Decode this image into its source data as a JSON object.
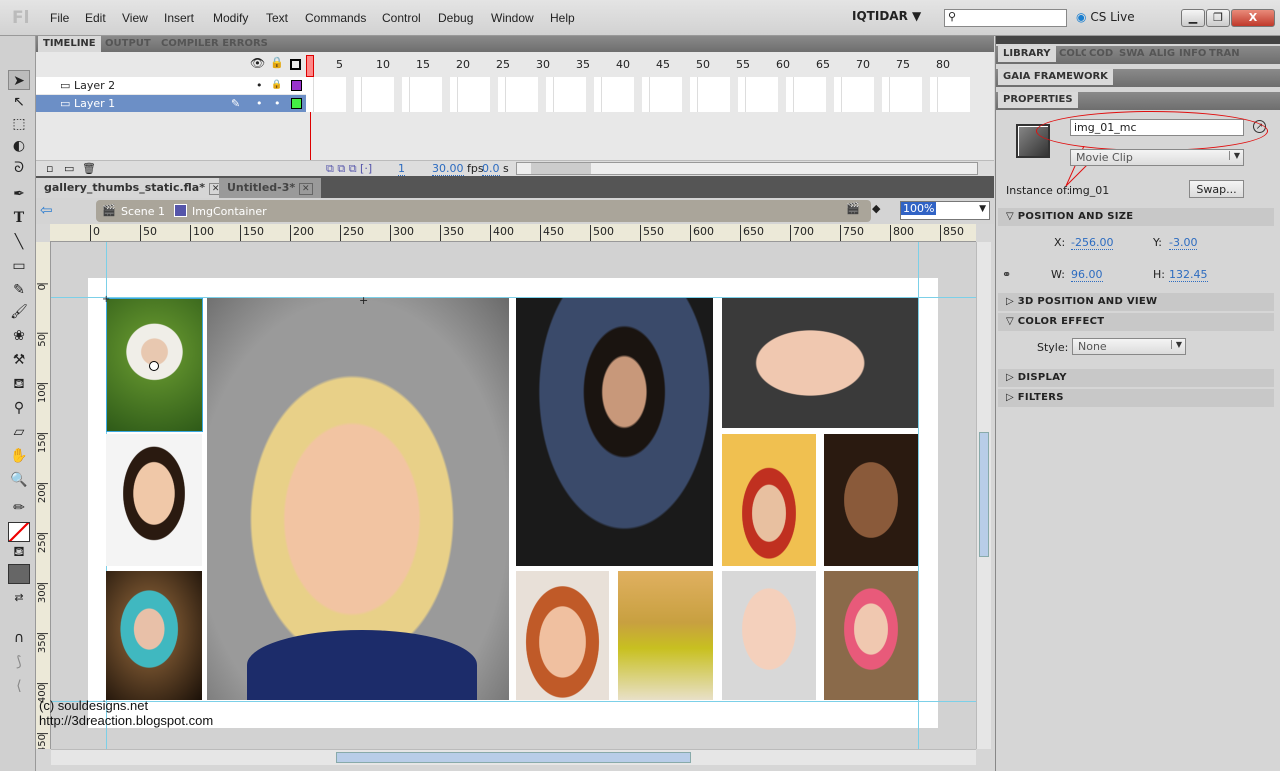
{
  "menubar": {
    "logo": "Fl",
    "items": [
      "File",
      "Edit",
      "View",
      "Insert",
      "Modify",
      "Text",
      "Commands",
      "Control",
      "Debug",
      "Window",
      "Help"
    ],
    "workspace": "IQTIDAR ▼",
    "search_placeholder": "",
    "cs_live": "CS Live"
  },
  "timeline": {
    "tabs": [
      "TIMELINE",
      "OUTPUT",
      "COMPILER ERRORS"
    ],
    "layers": [
      {
        "name": "Layer 2",
        "color": "#9933cc",
        "locked": true,
        "selected": false
      },
      {
        "name": "Layer 1",
        "color": "#44ee44",
        "locked": false,
        "selected": true
      }
    ],
    "frame_numbers": [
      "5",
      "10",
      "15",
      "20",
      "25",
      "30",
      "35",
      "40",
      "45",
      "50",
      "55",
      "60",
      "65",
      "70",
      "75",
      "80"
    ],
    "current_frame": "1",
    "fps": "30.00",
    "fps_unit": "fps",
    "time": "0.0",
    "time_unit": "s"
  },
  "documents": {
    "tabs": [
      "gallery_thumbs_static.fla*",
      "Untitled-3*"
    ],
    "breadcrumb": [
      "Scene 1",
      "ImgContainer"
    ],
    "zoom": "100%"
  },
  "rulers": {
    "horizontal": [
      "0",
      "50",
      "100",
      "150",
      "200",
      "250",
      "300",
      "350",
      "400",
      "450",
      "500",
      "550",
      "600",
      "650",
      "700",
      "750",
      "800",
      "850"
    ],
    "vertical": [
      "0",
      "50",
      "100",
      "150",
      "200",
      "250",
      "300",
      "350",
      "400",
      "450"
    ]
  },
  "watermark": [
    "(c) souldesigns.net",
    "http://3dreaction.blogspot.com"
  ],
  "right_panel": {
    "tabs": [
      "LIBRARY",
      "COLO",
      "COD",
      "SWA",
      "ALIG",
      "INFO",
      "TRAN"
    ],
    "gaia": "GAIA FRAMEWORK",
    "properties": {
      "title": "PROPERTIES",
      "instance_name": "img_01_mc",
      "symbol_type": "Movie Clip",
      "instance_of_label": "Instance of:",
      "instance_of": "img_01",
      "swap": "Swap...",
      "position_and_size": "POSITION AND SIZE",
      "x_label": "X:",
      "x": "-256.00",
      "y_label": "Y:",
      "y": "-3.00",
      "w_label": "W:",
      "w": "96.00",
      "h_label": "H:",
      "h": "132.45",
      "sections": [
        "3D POSITION AND VIEW",
        "COLOR EFFECT",
        "DISPLAY",
        "FILTERS"
      ],
      "style_label": "Style:",
      "style": "None"
    }
  },
  "colors": {
    "selection": "#6c8fc6",
    "annotation": "#e01010",
    "accent": "#2d6cc0"
  }
}
